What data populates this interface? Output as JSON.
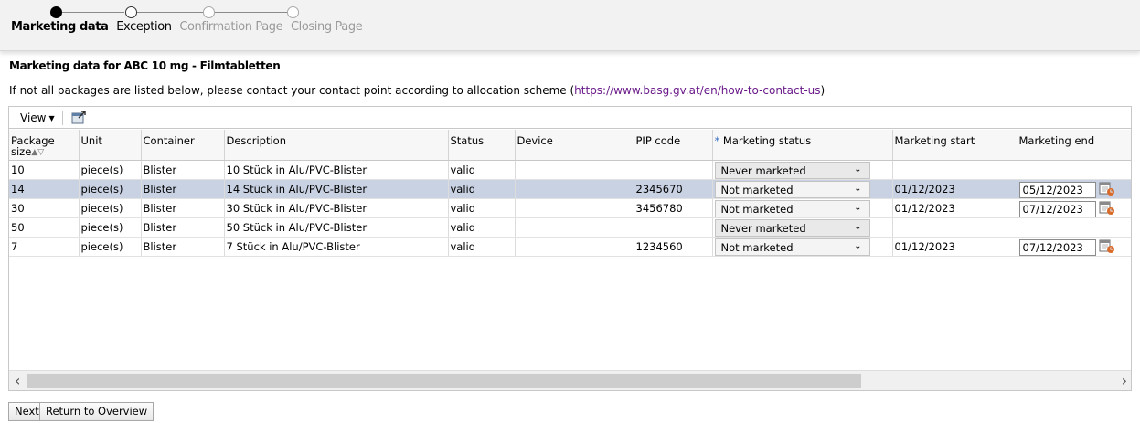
{
  "stepper": {
    "steps": [
      {
        "label": "Marketing data",
        "state": "active"
      },
      {
        "label": "Exception",
        "state": "current"
      },
      {
        "label": "Confirmation Page",
        "state": "future"
      },
      {
        "label": "Closing Page",
        "state": "future"
      }
    ]
  },
  "header": {
    "title": "Marketing data for ABC 10 mg - Filmtabletten",
    "info_text": "If not all packages are listed below, please contact your contact point according to allocation scheme (",
    "info_link": "https://www.basg.gv.at/en/how-to-contact-us",
    "info_suffix": ")"
  },
  "toolbar": {
    "view_label": "View",
    "detach_icon": "detach-icon"
  },
  "table": {
    "columns": [
      {
        "label": "Package size",
        "required": false
      },
      {
        "label": "Unit",
        "required": false
      },
      {
        "label": "Container",
        "required": false
      },
      {
        "label": "Description",
        "required": false
      },
      {
        "label": "Status",
        "required": false
      },
      {
        "label": "Device",
        "required": false
      },
      {
        "label": "PIP code",
        "required": false
      },
      {
        "label": "Marketing status",
        "required": true
      },
      {
        "label": "Marketing start",
        "required": false
      },
      {
        "label": "Marketing end",
        "required": false
      }
    ],
    "rows": [
      {
        "size": "10",
        "unit": "piece(s)",
        "container": "Blister",
        "description": "10 Stück in Alu/PVC-Blister",
        "status": "valid",
        "device": "",
        "pip": "",
        "marketing_status": "Never marketed",
        "start": "",
        "end": "",
        "selected": false
      },
      {
        "size": "14",
        "unit": "piece(s)",
        "container": "Blister",
        "description": "14 Stück in Alu/PVC-Blister",
        "status": "valid",
        "device": "",
        "pip": "2345670",
        "marketing_status": "Not marketed",
        "start": "01/12/2023",
        "end": "05/12/2023",
        "selected": true
      },
      {
        "size": "30",
        "unit": "piece(s)",
        "container": "Blister",
        "description": "30 Stück in Alu/PVC-Blister",
        "status": "valid",
        "device": "",
        "pip": "3456780",
        "marketing_status": "Not marketed",
        "start": "01/12/2023",
        "end": "07/12/2023",
        "selected": false
      },
      {
        "size": "50",
        "unit": "piece(s)",
        "container": "Blister",
        "description": "50 Stück in Alu/PVC-Blister",
        "status": "valid",
        "device": "",
        "pip": "",
        "marketing_status": "Never marketed",
        "start": "",
        "end": "",
        "selected": false
      },
      {
        "size": "7",
        "unit": "piece(s)",
        "container": "Blister",
        "description": "7 Stück in Alu/PVC-Blister",
        "status": "valid",
        "device": "",
        "pip": "1234560",
        "marketing_status": "Not marketed",
        "start": "01/12/2023",
        "end": "07/12/2023",
        "selected": false
      }
    ]
  },
  "scrollbar": {
    "left_arrow": "‹",
    "right_arrow": "›"
  },
  "buttons": {
    "next": "Next",
    "return": "Return to Overview"
  },
  "colors": {
    "selected_row": "#c9d2e3",
    "link": "#6a1a8a",
    "required_star": "#3a6fc0"
  }
}
